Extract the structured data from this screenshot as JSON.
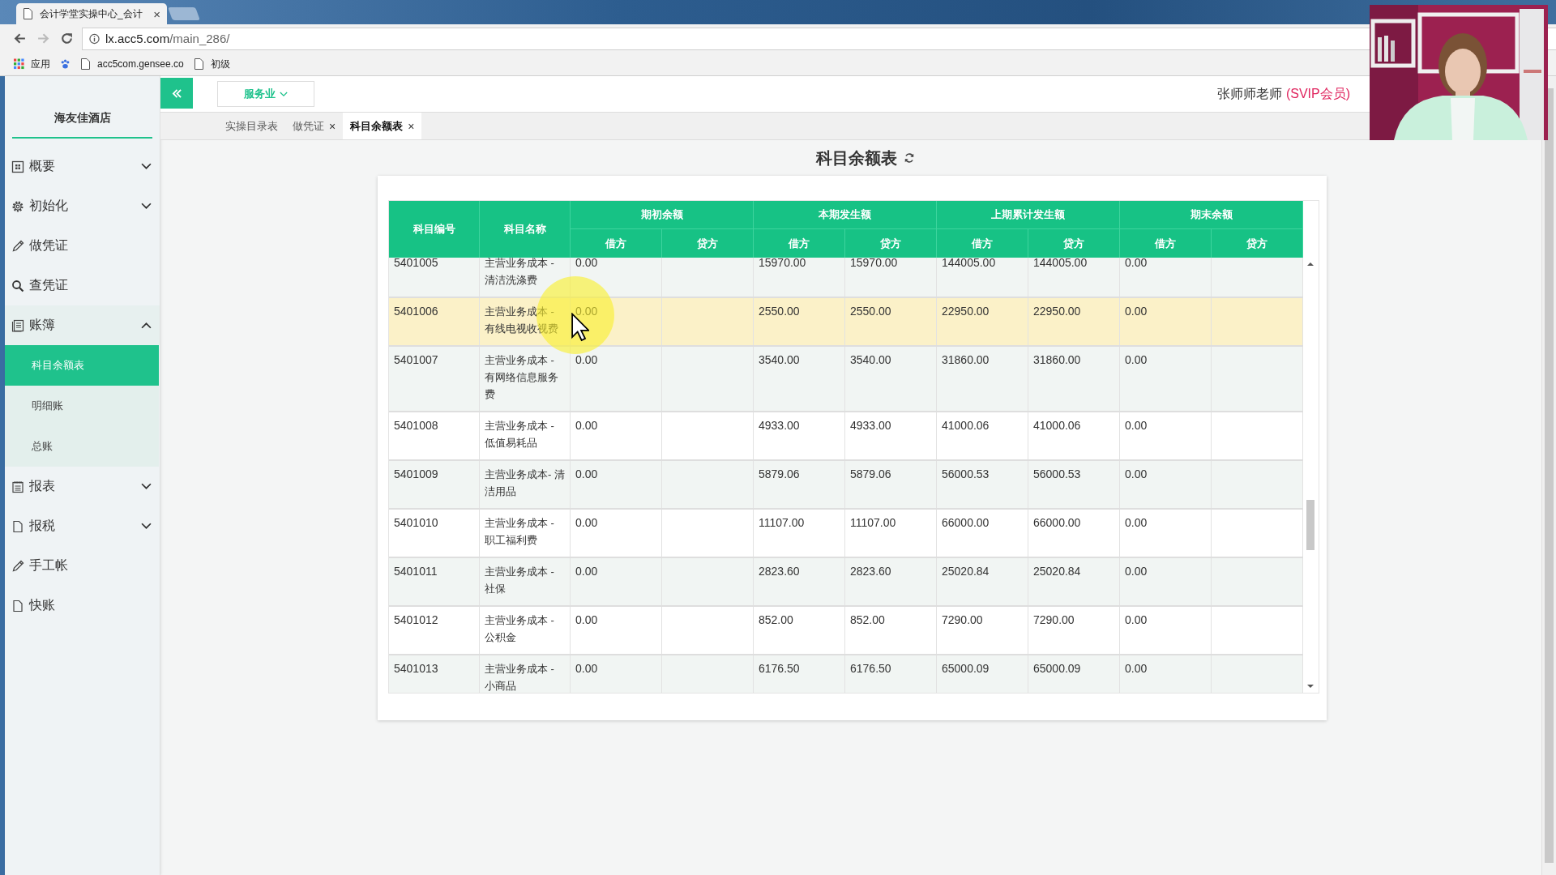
{
  "browser": {
    "tab_title": "会计学堂实操中心_会计",
    "tab_close": "×",
    "url_host": "lx.acc5.com",
    "url_path": "/main_286/",
    "bookmarks": [
      "应用",
      "acc5com.gensee.co",
      "初级"
    ]
  },
  "app": {
    "company": "海友佳酒店",
    "industry": "服务业",
    "user_name": "张师师老师",
    "user_badge": "(SVIP会员)",
    "tabs": [
      {
        "label": "实操目录表",
        "selected": false
      },
      {
        "label": "做凭证",
        "selected": false,
        "close": "×"
      },
      {
        "label": "科目余额表",
        "selected": true,
        "close": "×"
      }
    ],
    "sidebar": [
      {
        "label": "概要",
        "expanded": false
      },
      {
        "label": "初始化",
        "expanded": false
      },
      {
        "label": "做凭证"
      },
      {
        "label": "查凭证"
      },
      {
        "label": "账簿",
        "expanded": true,
        "children": [
          {
            "label": "科目余额表",
            "selected": true
          },
          {
            "label": "明细账",
            "selected": false
          },
          {
            "label": "总账",
            "selected": false
          }
        ]
      },
      {
        "label": "报表",
        "expanded": false
      },
      {
        "label": "报税",
        "expanded": false
      },
      {
        "label": "手工帐"
      },
      {
        "label": "快账"
      }
    ],
    "page_title": "科目余额表",
    "table": {
      "columns": [
        "科目编号",
        "科目名称"
      ],
      "groups": [
        {
          "label": "期初余额",
          "sub": [
            "借方",
            "贷方"
          ]
        },
        {
          "label": "本期发生额",
          "sub": [
            "借方",
            "贷方"
          ]
        },
        {
          "label": "上期累计发生额",
          "sub": [
            "借方",
            "贷方"
          ]
        },
        {
          "label": "期末余额",
          "sub": [
            "借方",
            "贷方"
          ]
        }
      ],
      "rows": [
        {
          "code": "5401005",
          "name": "主营业务成本 - 清洁洗涤费",
          "hovered": false,
          "opening_debit": "0.00",
          "period_debit": "15970.00",
          "period_credit": "15970.00",
          "ytd_debit": "144005.00",
          "ytd_credit": "144005.00",
          "closing_debit": "0.00"
        },
        {
          "code": "5401006",
          "name": "主营业务成本 - 有线电视收视费",
          "hovered": true,
          "opening_debit": "0.00",
          "period_debit": "2550.00",
          "period_credit": "2550.00",
          "ytd_debit": "22950.00",
          "ytd_credit": "22950.00",
          "closing_debit": "0.00"
        },
        {
          "code": "5401007",
          "name": "主营业务成本 - 有网络信息服务费",
          "hovered": false,
          "opening_debit": "0.00",
          "period_debit": "3540.00",
          "period_credit": "3540.00",
          "ytd_debit": "31860.00",
          "ytd_credit": "31860.00",
          "closing_debit": "0.00"
        },
        {
          "code": "5401008",
          "name": "主营业务成本 - 低值易耗品",
          "hovered": false,
          "opening_debit": "0.00",
          "period_debit": "4933.00",
          "period_credit": "4933.00",
          "ytd_debit": "41000.06",
          "ytd_credit": "41000.06",
          "closing_debit": "0.00"
        },
        {
          "code": "5401009",
          "name": "主营业务成本- 清洁用品",
          "hovered": false,
          "opening_debit": "0.00",
          "period_debit": "5879.06",
          "period_credit": "5879.06",
          "ytd_debit": "56000.53",
          "ytd_credit": "56000.53",
          "closing_debit": "0.00"
        },
        {
          "code": "5401010",
          "name": "主营业务成本 - 职工福利费",
          "hovered": false,
          "opening_debit": "0.00",
          "period_debit": "11107.00",
          "period_credit": "11107.00",
          "ytd_debit": "66000.00",
          "ytd_credit": "66000.00",
          "closing_debit": "0.00"
        },
        {
          "code": "5401011",
          "name": "主营业务成本 - 社保",
          "hovered": false,
          "opening_debit": "0.00",
          "period_debit": "2823.60",
          "period_credit": "2823.60",
          "ytd_debit": "25020.84",
          "ytd_credit": "25020.84",
          "closing_debit": "0.00"
        },
        {
          "code": "5401012",
          "name": "主营业务成本 - 公积金",
          "hovered": false,
          "opening_debit": "0.00",
          "period_debit": "852.00",
          "period_credit": "852.00",
          "ytd_debit": "7290.00",
          "ytd_credit": "7290.00",
          "closing_debit": "0.00"
        },
        {
          "code": "5401013",
          "name": "主营业务成本 - 小商品",
          "hovered": false,
          "opening_debit": "0.00",
          "period_debit": "6176.50",
          "period_credit": "6176.50",
          "ytd_debit": "65000.09",
          "ytd_credit": "65000.09",
          "closing_debit": "0.00"
        }
      ]
    }
  }
}
